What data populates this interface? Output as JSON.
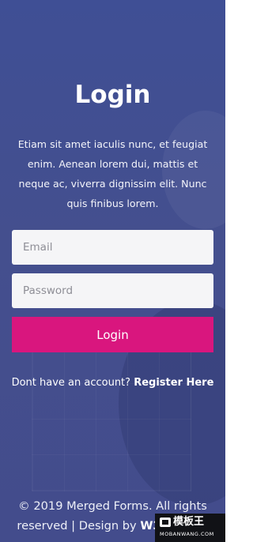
{
  "form": {
    "title": "Login",
    "description": "Etiam sit amet iaculis nunc, et feugiat enim. Aenean lorem dui, mattis et neque ac, viverra dignissim elit. Nunc quis finibus lorem.",
    "email_placeholder": "Email",
    "password_placeholder": "Password",
    "submit_label": "Login",
    "register_prompt": "Dont have an account? ",
    "register_link": "Register Here"
  },
  "footer": {
    "text": "© 2019 Merged Forms. All rights reserved | Design by ",
    "brand": "W3layouts"
  },
  "watermark": {
    "title": "模板王",
    "subtitle": "MOBANWANG.COM"
  }
}
